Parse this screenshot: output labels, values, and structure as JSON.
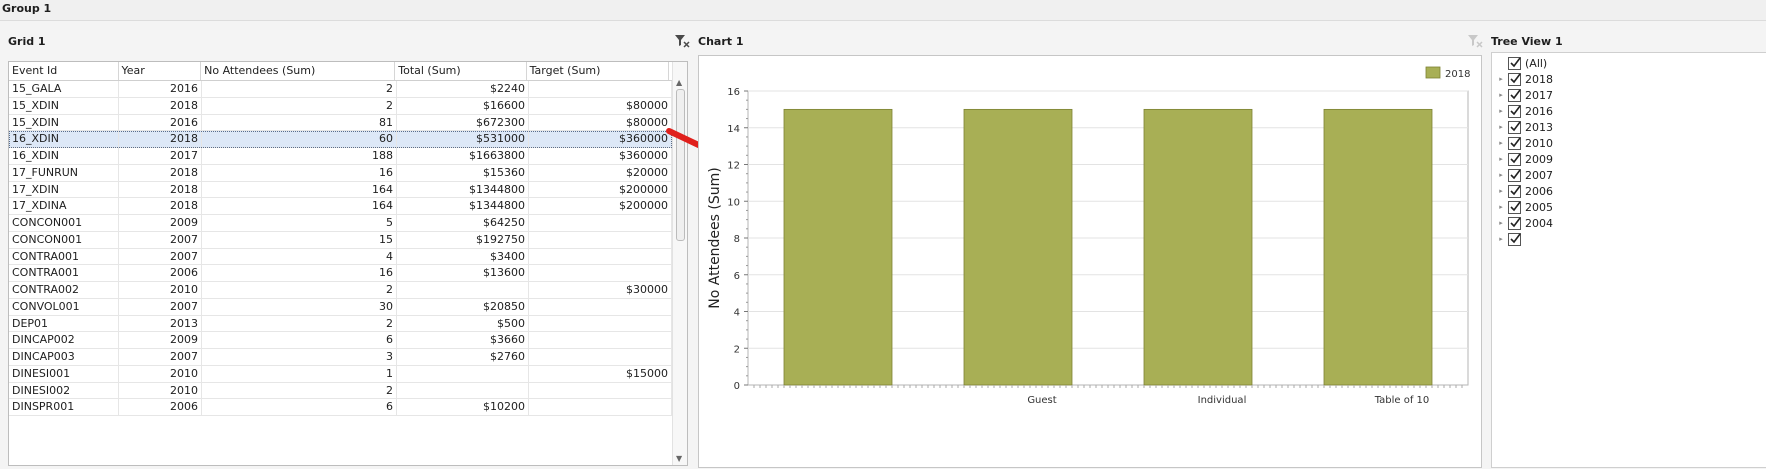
{
  "group": {
    "title": "Group 1"
  },
  "grid": {
    "title": "Grid 1",
    "columns": [
      "Event Id",
      "Year",
      "No Attendees (Sum)",
      "Total (Sum)",
      "Target (Sum)"
    ],
    "rows": [
      [
        "15_GALA",
        "2016",
        "2",
        "$2240",
        ""
      ],
      [
        "15_XDIN",
        "2018",
        "2",
        "$16600",
        "$80000"
      ],
      [
        "15_XDIN",
        "2016",
        "81",
        "$672300",
        "$80000"
      ],
      [
        "16_XDIN",
        "2018",
        "60",
        "$531000",
        "$360000"
      ],
      [
        "16_XDIN",
        "2017",
        "188",
        "$1663800",
        "$360000"
      ],
      [
        "17_FUNRUN",
        "2018",
        "16",
        "$15360",
        "$20000"
      ],
      [
        "17_XDIN",
        "2018",
        "164",
        "$1344800",
        "$200000"
      ],
      [
        "17_XDINA",
        "2018",
        "164",
        "$1344800",
        "$200000"
      ],
      [
        "CONCON001",
        "2009",
        "5",
        "$64250",
        ""
      ],
      [
        "CONCON001",
        "2007",
        "15",
        "$192750",
        ""
      ],
      [
        "CONTRA001",
        "2007",
        "4",
        "$3400",
        ""
      ],
      [
        "CONTRA001",
        "2006",
        "16",
        "$13600",
        ""
      ],
      [
        "CONTRA002",
        "2010",
        "2",
        "",
        "$30000"
      ],
      [
        "CONVOL001",
        "2007",
        "30",
        "$20850",
        ""
      ],
      [
        "DEP01",
        "2013",
        "2",
        "$500",
        ""
      ],
      [
        "DINCAP002",
        "2009",
        "6",
        "$3660",
        ""
      ],
      [
        "DINCAP003",
        "2007",
        "3",
        "$2760",
        ""
      ],
      [
        "DINESI001",
        "2010",
        "1",
        "",
        "$15000"
      ],
      [
        "DINESI002",
        "2010",
        "2",
        "",
        ""
      ],
      [
        "DINSPR001",
        "2006",
        "6",
        "$10200",
        ""
      ]
    ],
    "selected_row": 3
  },
  "chart": {
    "title": "Chart 1"
  },
  "chart_data": {
    "type": "bar",
    "categories": [
      "",
      "Guest",
      "Individual",
      "Table of 10"
    ],
    "series": [
      {
        "name": "2018",
        "values": [
          15,
          15,
          15,
          15
        ],
        "color": "#a8af55"
      }
    ],
    "ylabel": "No Attendees (Sum)",
    "xlabel": "",
    "ylim": [
      0,
      16
    ],
    "yticks": [
      "0",
      "2",
      "4",
      "6",
      "8",
      "10",
      "12",
      "14",
      "16"
    ],
    "legend": "top-right",
    "grid": true
  },
  "tree": {
    "title": "Tree View 1",
    "items": [
      "(All)",
      "2018",
      "2017",
      "2016",
      "2013",
      "2010",
      "2009",
      "2007",
      "2006",
      "2005",
      "2004",
      ""
    ]
  },
  "colors": {
    "bar": "#a8af55",
    "bar_border": "#7d8233",
    "selection": "#dde8f7",
    "arrow": "#e0201c"
  }
}
